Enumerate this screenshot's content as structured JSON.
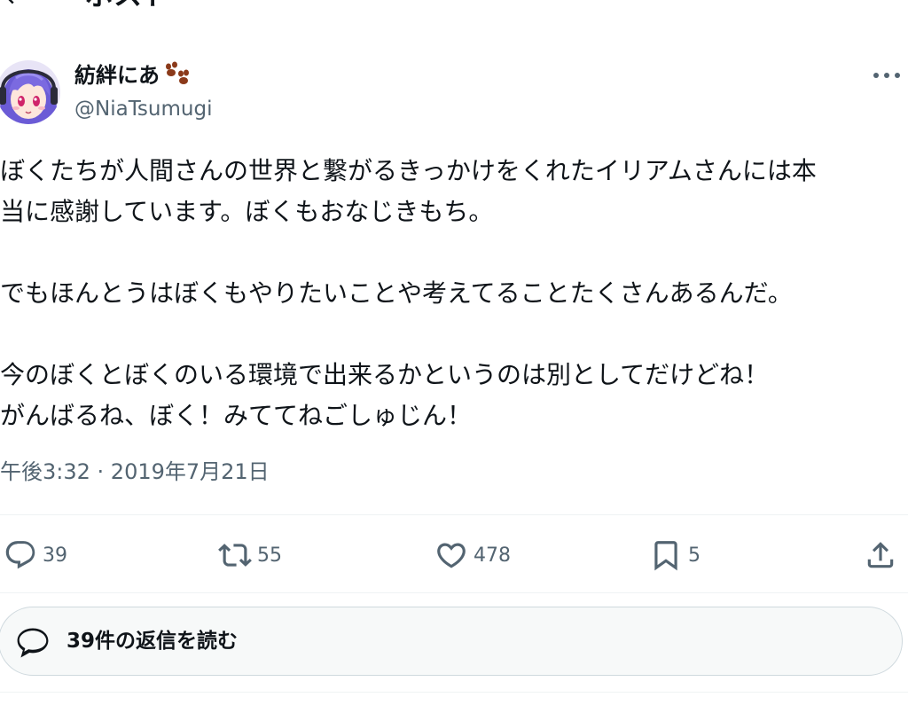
{
  "header": {
    "title": "ポスト"
  },
  "author": {
    "name": "紡絆にあ",
    "handle": "@NiaTsumugi"
  },
  "tweet": {
    "text": "ぼくたちが人間さんの世界と繋がるきっかけをくれたイリアムさんには本\n当に感謝しています。ぼくもおなじきもち。\n\nでもほんとうはぼくもやりたいことや考えてることたくさんあるんだ。\n\n今のぼくとぼくのいる環境で出来るかというのは別としてだけどね！\nがんばるね、ぼく！みててねごしゅじん！",
    "time": "午後3:32",
    "separator": " · ",
    "date": "2019年7月21日"
  },
  "actions": {
    "replies": "39",
    "reposts": "55",
    "likes": "478",
    "bookmarks": "5"
  },
  "replies_button": {
    "label": "39件の返信を読む"
  },
  "icons": {
    "back": "arrow-left-icon",
    "paw": "paw-emoji-icon",
    "more": "more-dots-icon",
    "reply": "reply-bubble-icon",
    "repost": "repost-icon",
    "like": "heart-icon",
    "bookmark": "bookmark-icon",
    "share": "share-upload-icon",
    "read_replies": "speech-bubble-icon"
  },
  "colors": {
    "text_primary": "#0f1419",
    "text_secondary": "#536471",
    "border": "#cfd9de",
    "divider": "#eff3f4",
    "paw": "#8b3a1a",
    "avatar_hair": "#6b5bd6"
  }
}
